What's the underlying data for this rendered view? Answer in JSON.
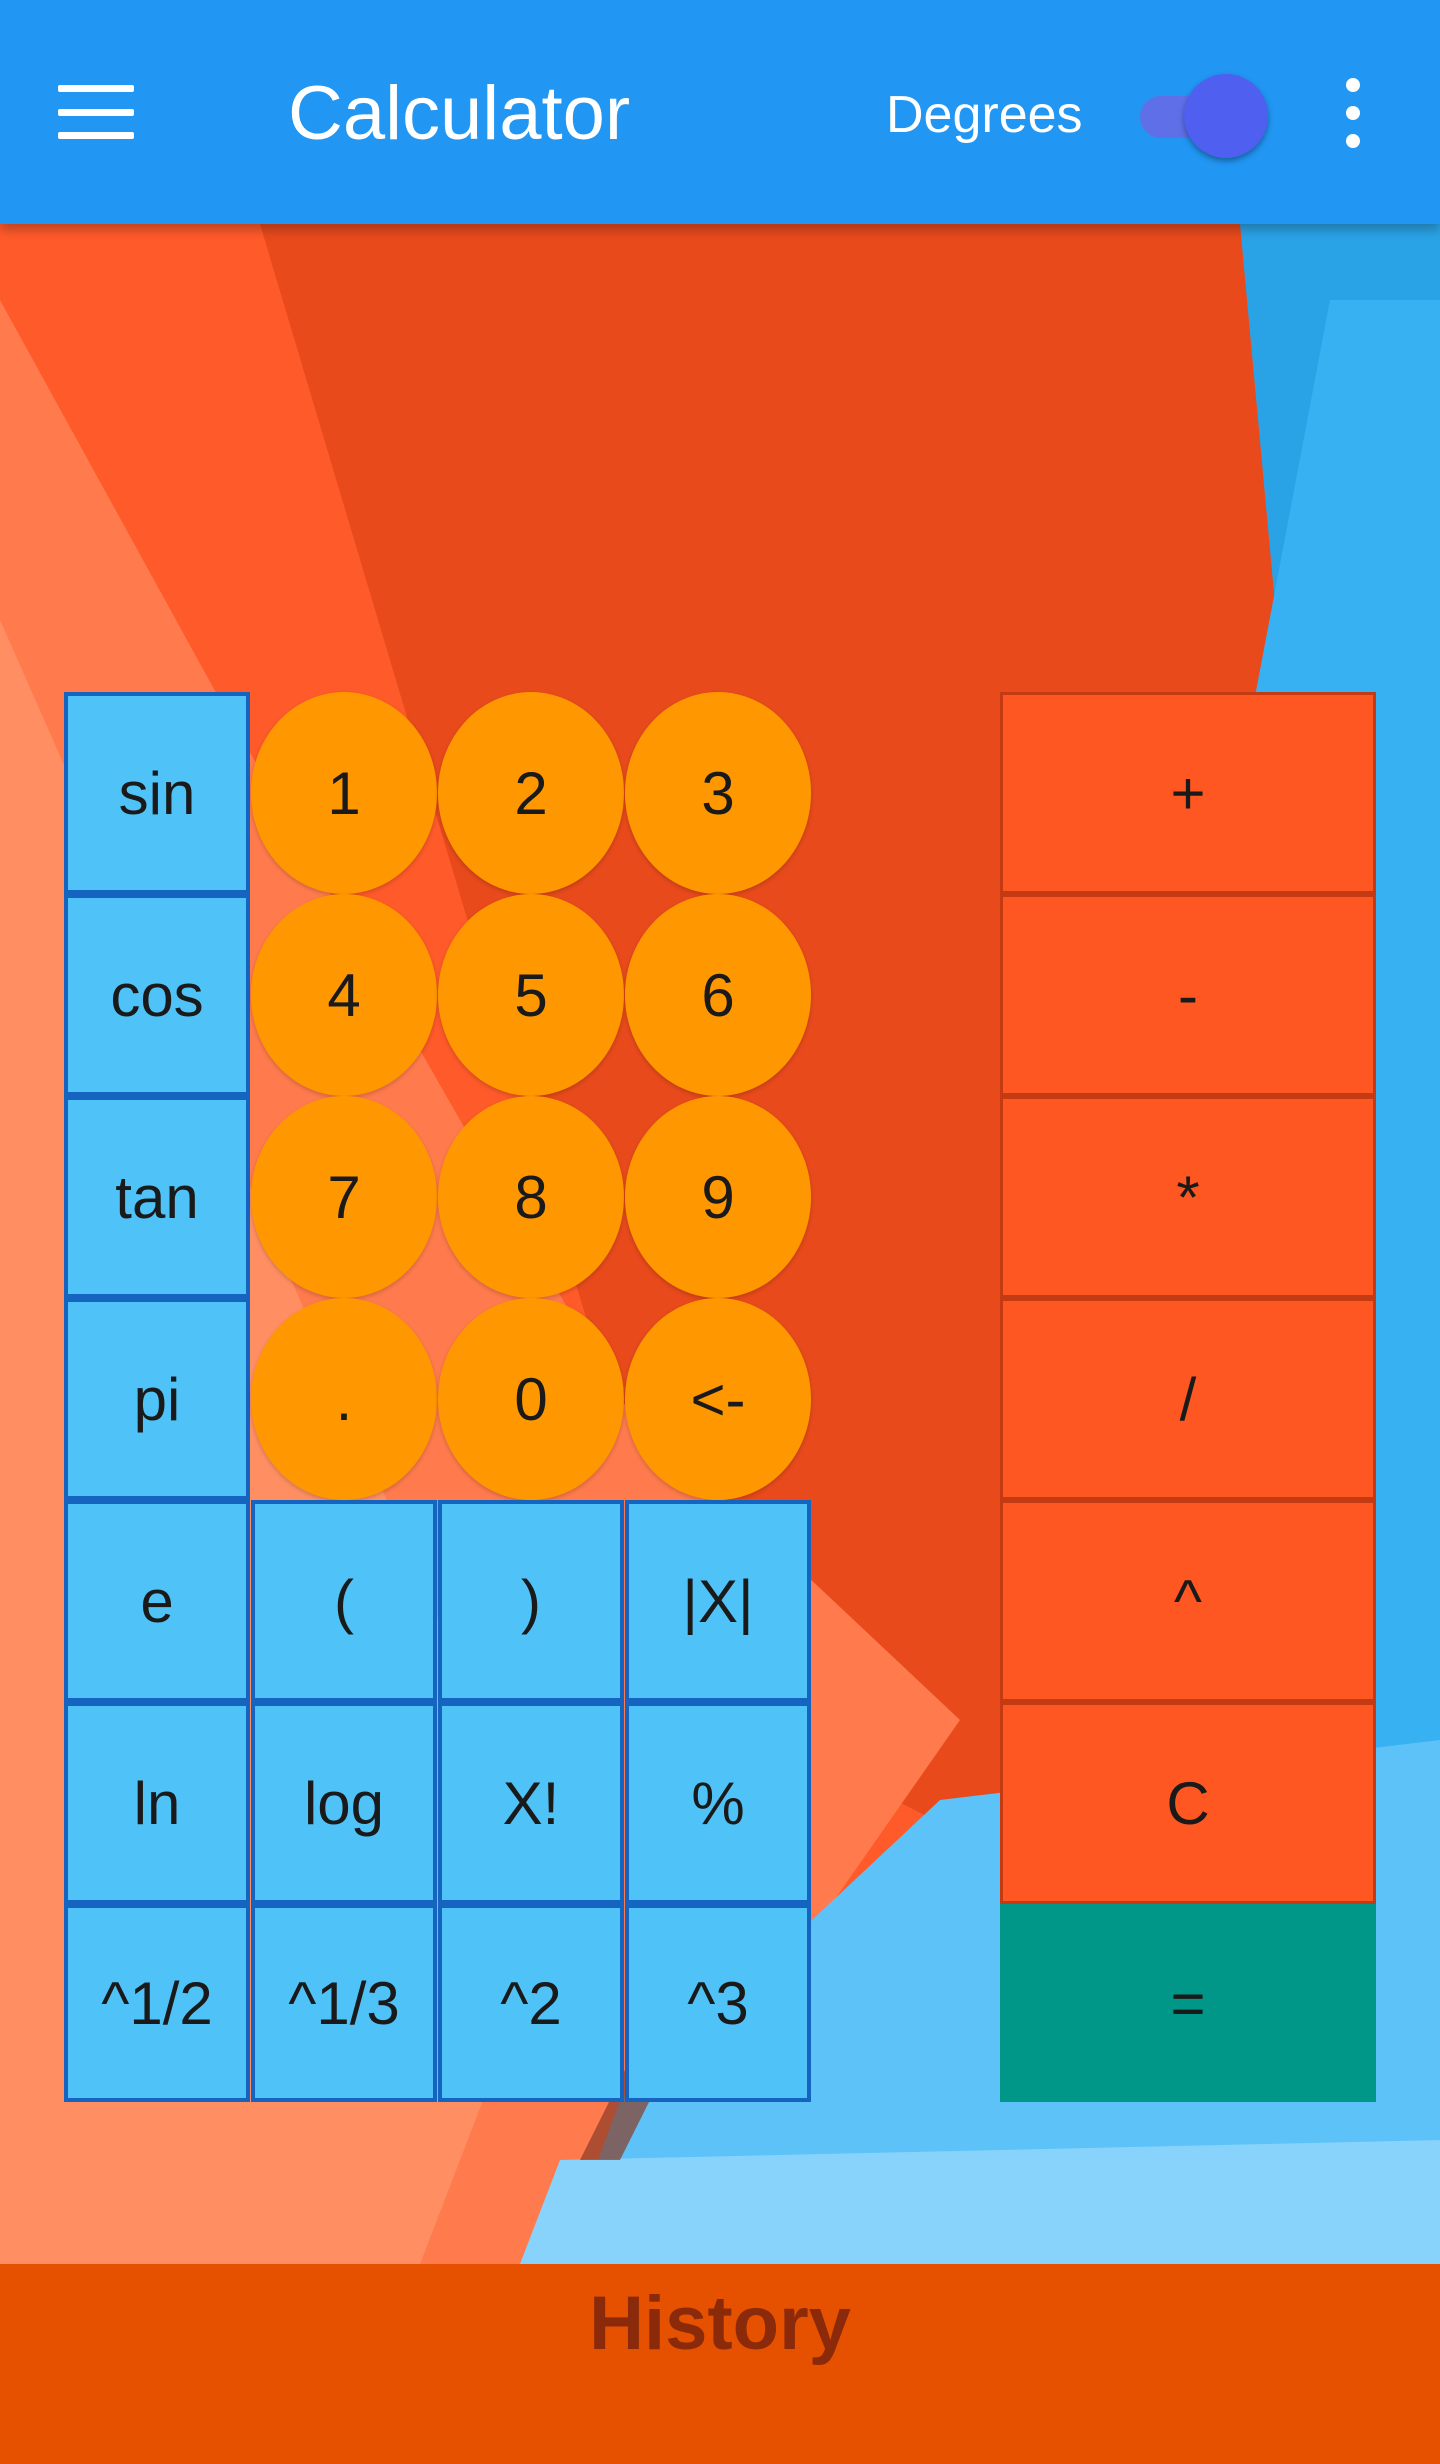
{
  "appbar": {
    "title": "Calculator",
    "mode_label": "Degrees",
    "mode_switch_on": true,
    "menu_icon": "menu-icon",
    "overflow_icon": "more-vert-icon"
  },
  "keypad": {
    "functions": [
      "sin",
      "cos",
      "tan",
      "pi",
      "e",
      "ln",
      "^1/2"
    ],
    "digits": [
      "1",
      "2",
      "3",
      "4",
      "5",
      "6",
      "7",
      "8",
      "9",
      ".",
      "0",
      "<-"
    ],
    "extras": [
      "(",
      ")",
      "|X|",
      "log",
      "X!",
      "%",
      "^1/3",
      "^2",
      "^3"
    ],
    "operators": [
      "+",
      "-",
      "*",
      "/",
      "^",
      "C"
    ],
    "equals": "="
  },
  "history": {
    "label": "History"
  },
  "colors": {
    "appbar": "#2196f3",
    "function_key": "#4fc3f7",
    "digit_key": "#ff9800",
    "operator_key": "#ff5722",
    "equals_key": "#009688",
    "history_bar": "#e65100"
  }
}
